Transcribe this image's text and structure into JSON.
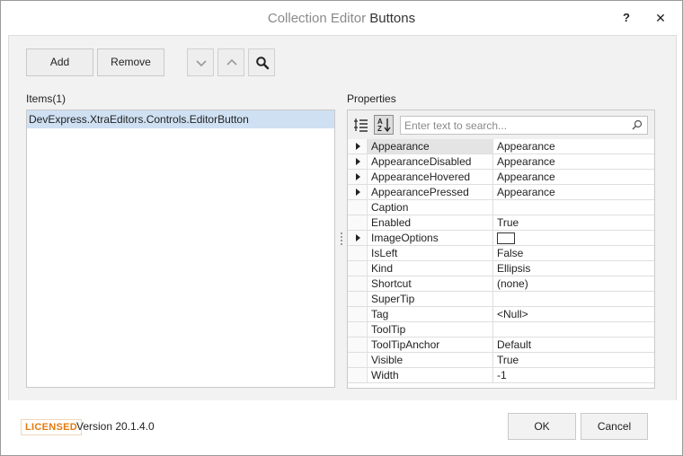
{
  "window": {
    "title_prefix": "Collection Editor",
    "title_name": "Buttons",
    "help_glyph": "?",
    "close_glyph": "✕"
  },
  "toolbar": {
    "add_label": "Add",
    "remove_label": "Remove",
    "move_down_icon": "chevron-down-icon",
    "move_up_icon": "chevron-up-icon",
    "search_icon": "search-icon"
  },
  "items": {
    "header": "Items(1)",
    "list": [
      "DevExpress.XtraEditors.Controls.EditorButton"
    ]
  },
  "properties": {
    "header": "Properties",
    "search_placeholder": "Enter text to search...",
    "rows": [
      {
        "name": "Appearance",
        "value": "Appearance",
        "expandable": true,
        "selected": true
      },
      {
        "name": "AppearanceDisabled",
        "value": "Appearance",
        "expandable": true
      },
      {
        "name": "AppearanceHovered",
        "value": "Appearance",
        "expandable": true
      },
      {
        "name": "AppearancePressed",
        "value": "Appearance",
        "expandable": true
      },
      {
        "name": "Caption",
        "value": ""
      },
      {
        "name": "Enabled",
        "value": "True"
      },
      {
        "name": "ImageOptions",
        "value": "",
        "expandable": true,
        "image_swatch": true
      },
      {
        "name": "IsLeft",
        "value": "False"
      },
      {
        "name": "Kind",
        "value": "Ellipsis"
      },
      {
        "name": "Shortcut",
        "value": "(none)"
      },
      {
        "name": "SuperTip",
        "value": ""
      },
      {
        "name": "Tag",
        "value": "<Null>"
      },
      {
        "name": "ToolTip",
        "value": ""
      },
      {
        "name": "ToolTipAnchor",
        "value": "Default"
      },
      {
        "name": "Visible",
        "value": "True"
      },
      {
        "name": "Width",
        "value": "-1"
      }
    ]
  },
  "footer": {
    "license_badge": "LICENSED",
    "version": "Version 20.1.4.0",
    "ok_label": "OK",
    "cancel_label": "Cancel"
  },
  "colors": {
    "accent_selection": "#cfe0f3",
    "license_orange": "#e57a0c"
  }
}
